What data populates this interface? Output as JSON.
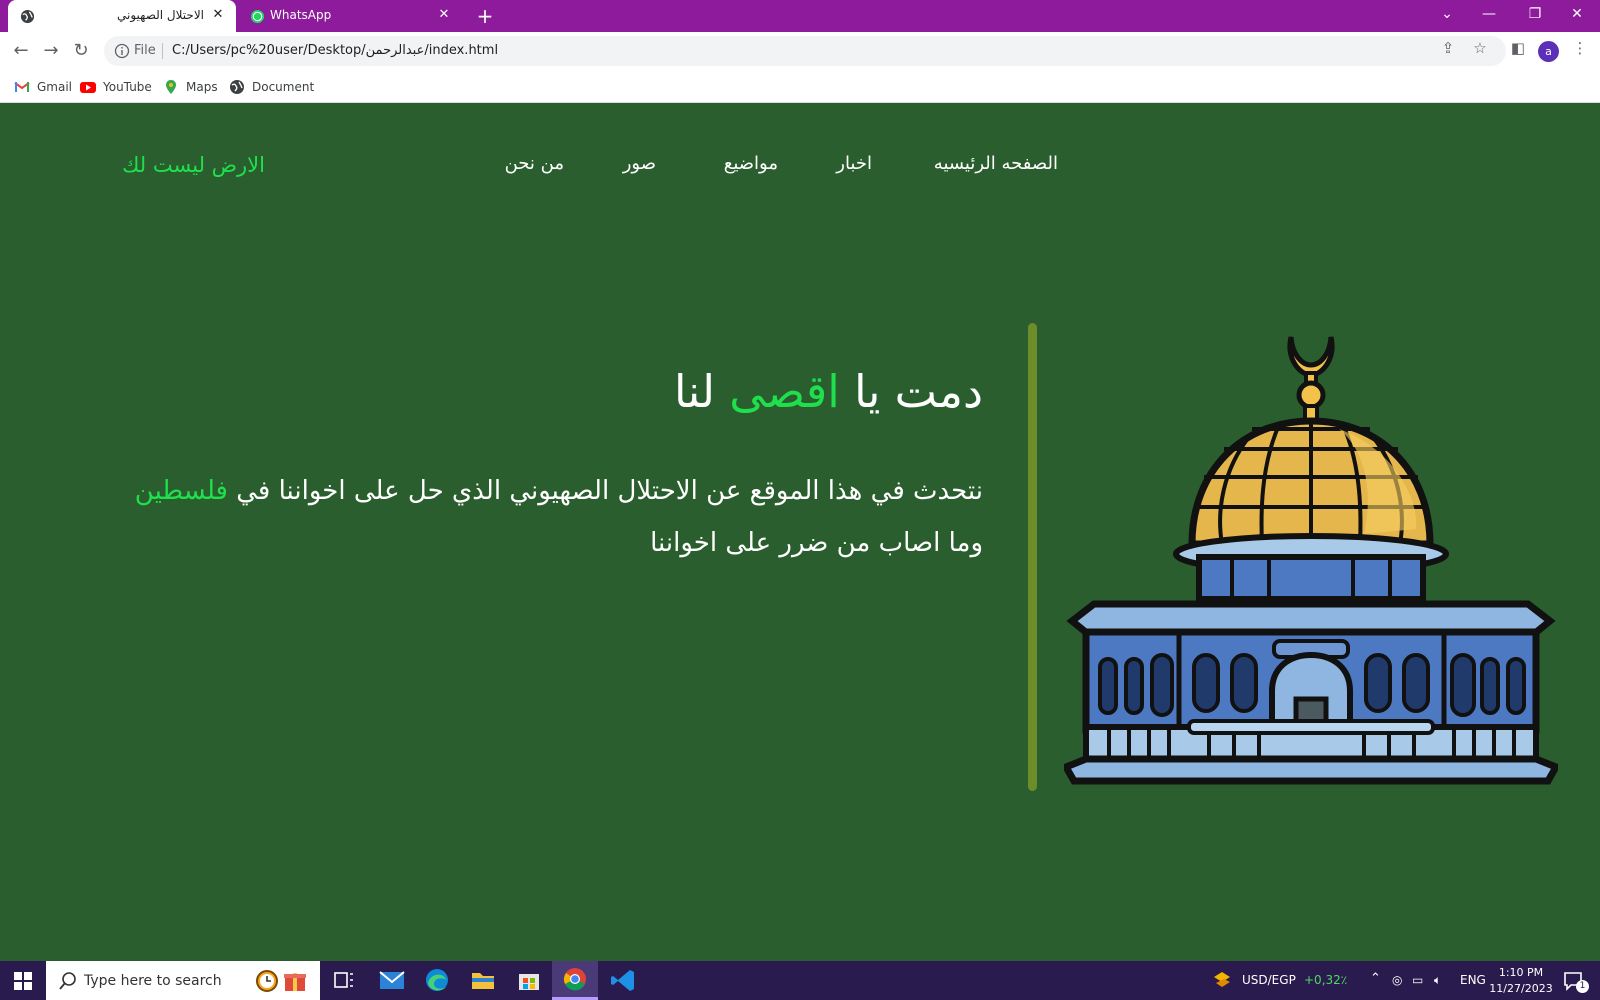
{
  "browser": {
    "tabs": [
      {
        "title": "الاحتلال الصهيوني",
        "active": true
      },
      {
        "title": "WhatsApp",
        "active": false
      }
    ],
    "new_tab_label": "+",
    "scheme": "File",
    "url": "C:/Users/pc%20user/Desktop/عبدالرحمن/index.html",
    "profile_initial": "a",
    "bookmarks": [
      "Gmail",
      "YouTube",
      "Maps",
      "Document"
    ]
  },
  "site": {
    "brand": "الارض ليست لك",
    "nav": [
      "الصفحه الرئيسيه",
      "اخبار",
      "مواضيع",
      "صور",
      "من نحن"
    ],
    "hero": {
      "title_before": "دمت يا ",
      "title_accent": "اقصى",
      "title_after": " لنا",
      "line1_before": "نتحدث في هذا الموقع عن الاحتلال الصهيوني الذي حل على اخواننا في ",
      "line1_accent": "فلسطين",
      "line2": "وما اصاب من ضرر على اخواننا"
    },
    "colors": {
      "background": "#2b5e2e",
      "accent": "#1fe04c",
      "divider": "#6c8d2a"
    }
  },
  "taskbar": {
    "search_placeholder": "Type here to search",
    "currency": "USD/EGP",
    "currency_change": "+0,32٪",
    "language": "ENG",
    "time": "1:10 PM",
    "date": "11/27/2023",
    "notification_count": "1"
  }
}
